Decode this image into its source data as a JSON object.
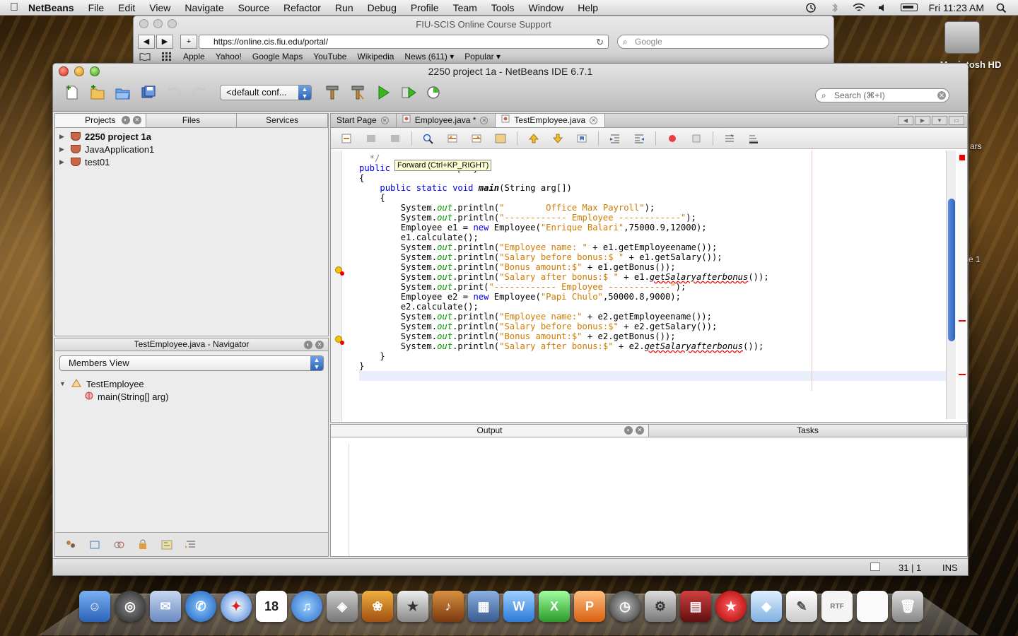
{
  "menubar": {
    "app_name": "NetBeans",
    "items": [
      "File",
      "Edit",
      "View",
      "Navigate",
      "Source",
      "Refactor",
      "Run",
      "Debug",
      "Profile",
      "Team",
      "Tools",
      "Window",
      "Help"
    ],
    "clock": "Fri 11:23 AM"
  },
  "safari": {
    "title": "FIU-SCIS Online Course Support",
    "url": "https://online.cis.fiu.edu/portal/",
    "search_placeholder": "Google",
    "bookmarks": [
      "Apple",
      "Yahoo!",
      "Google Maps",
      "YouTube",
      "Wikipedia",
      "News (611) ▾",
      "Popular ▾"
    ]
  },
  "desktop": {
    "hd_label": "Macintosh HD",
    "side_label_1": "ars",
    "side_label_2": "e 1"
  },
  "netbeans": {
    "title": "2250 project 1a - NetBeans IDE 6.7.1",
    "config": "<default conf...",
    "search_placeholder": "Search (⌘+I)",
    "left_tabs": [
      "Projects",
      "Files",
      "Services"
    ],
    "projects": [
      {
        "label": "2250 project 1a",
        "bold": true
      },
      {
        "label": "JavaApplication1",
        "bold": false
      },
      {
        "label": "test01",
        "bold": false
      }
    ],
    "navigator": {
      "title": "TestEmployee.java - Navigator",
      "view": "Members View",
      "class_name": "TestEmployee",
      "method": "main(String[] arg)"
    },
    "editor_tabs": [
      "Start Page",
      "Employee.java *",
      "TestEmployee.java"
    ],
    "tooltip": "Forward (Ctrl+KP_RIGHT)",
    "output_tabs": [
      "Output",
      "Tasks"
    ],
    "status": {
      "position": "31 | 1",
      "mode": "INS"
    }
  },
  "colors": {
    "accent_blue": "#2c63b8",
    "keyword": "#0000e6",
    "string": "#ce7b00",
    "field": "#009900",
    "error": "#e00000"
  }
}
